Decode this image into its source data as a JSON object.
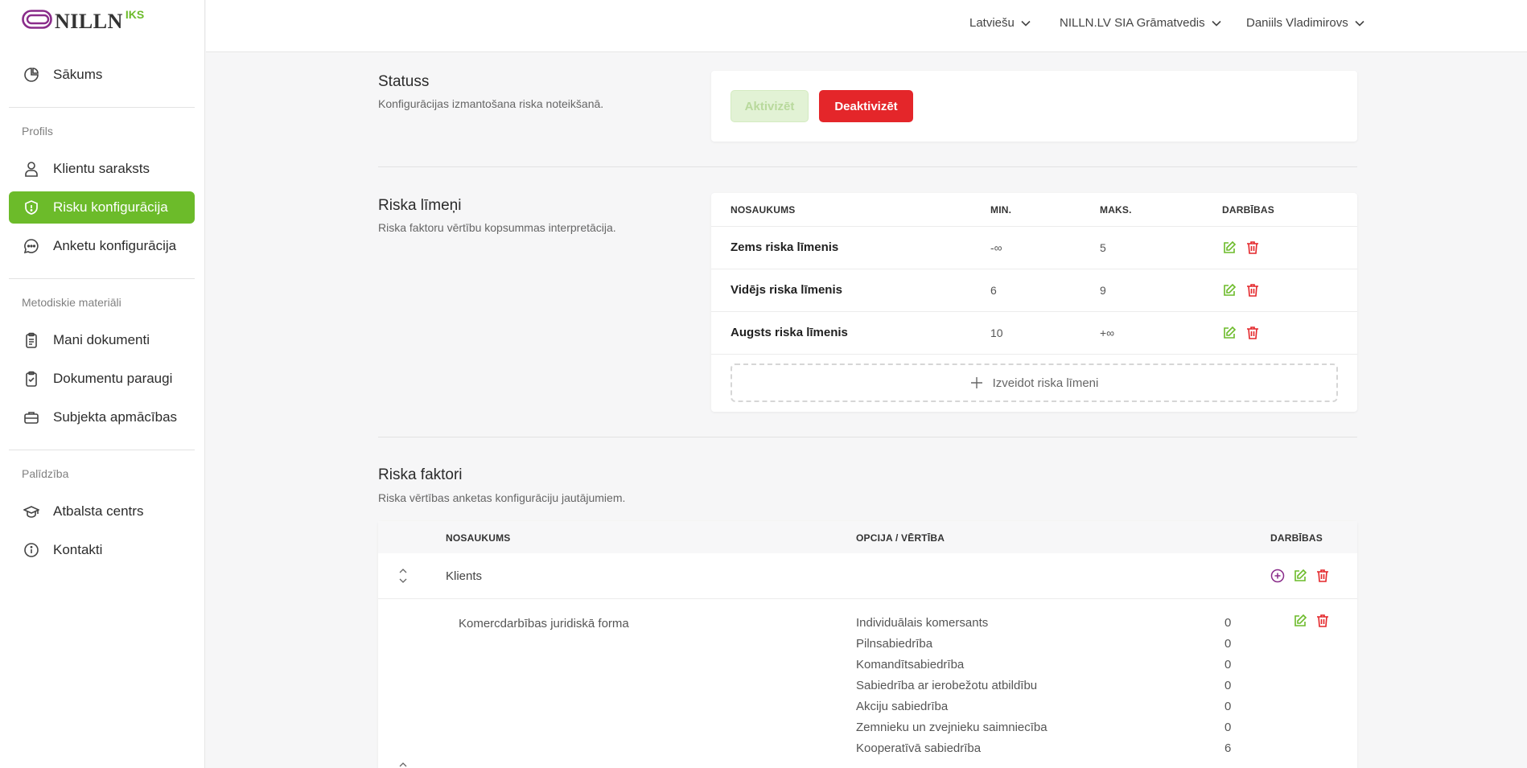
{
  "logo": {
    "brand": "NILLN",
    "sub": "IKS"
  },
  "sidebar": {
    "home": "Sākums",
    "sections": {
      "profile": "Profils",
      "methodical": "Metodiskie materiāli",
      "help": "Palīdzība"
    },
    "items": [
      {
        "label": "Klientu saraksts"
      },
      {
        "label": "Risku konfigurācija"
      },
      {
        "label": "Anketu konfigurācija"
      },
      {
        "label": "Mani dokumenti"
      },
      {
        "label": "Dokumentu paraugi"
      },
      {
        "label": "Subjekta apmācības"
      },
      {
        "label": "Atbalsta centrs"
      },
      {
        "label": "Kontakti"
      }
    ]
  },
  "topbar": {
    "language": "Latviešu",
    "company": "NILLN.LV SIA Grāmatvedis",
    "user": "Daniils Vladimirovs"
  },
  "status": {
    "title": "Statuss",
    "description": "Konfigurācijas izmantošana riska noteikšanā.",
    "activate_label": "Aktivizēt",
    "deactivate_label": "Deaktivizēt"
  },
  "levels": {
    "title": "Riska līmeņi",
    "description": "Riska faktoru vērtību kopsummas interpretācija.",
    "columns": {
      "name": "Nosaukums",
      "min": "Min.",
      "max": "Maks.",
      "actions": "Darbības"
    },
    "rows": [
      {
        "name": "Zems riska līmenis",
        "min": "-∞",
        "max": "5"
      },
      {
        "name": "Vidējs riska līmenis",
        "min": "6",
        "max": "9"
      },
      {
        "name": "Augsts riska līmenis",
        "min": "10",
        "max": "+∞"
      }
    ],
    "create_label": "Izveidot riska līmeni"
  },
  "factors": {
    "title": "Riska faktori",
    "description": "Riska vērtības anketas konfigurāciju jautājumiem.",
    "columns": {
      "name": "Nosaukums",
      "option": "Opcija / vērtība",
      "actions": "Darbības"
    },
    "group": "Klients",
    "question": "Komercdarbības juridiskā forma",
    "options": [
      {
        "label": "Individuālais komersants",
        "value": "0"
      },
      {
        "label": "Pilnsabiedrība",
        "value": "0"
      },
      {
        "label": "Komandītsabiedrība",
        "value": "0"
      },
      {
        "label": "Sabiedrība ar ierobežotu atbildību",
        "value": "0"
      },
      {
        "label": "Akciju sabiedrība",
        "value": "0"
      },
      {
        "label": "Zemnieku un zvejnieku saimniecība",
        "value": "0"
      },
      {
        "label": "Kooperatīvā sabiedrība",
        "value": "6"
      }
    ]
  },
  "colors": {
    "accent": "#6cbb2a",
    "danger": "#e4262a",
    "purple": "#8a2c8a"
  }
}
